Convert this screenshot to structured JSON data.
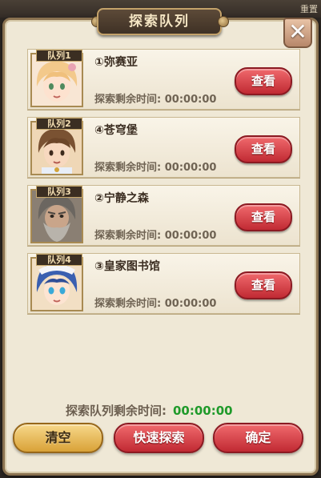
{
  "background": {
    "top_right_text": "重置"
  },
  "dialog": {
    "title": "探索队列",
    "close_symbol": "✕"
  },
  "queues": [
    {
      "tag": "队列1",
      "location": "①弥赛亚",
      "remaining_label": "探索剩余时间:",
      "remaining_time": "00:00:00",
      "button": "查看",
      "portrait": "blonde-girl-portrait"
    },
    {
      "tag": "队列2",
      "location": "④苍穹堡",
      "remaining_label": "探索剩余时间:",
      "remaining_time": "00:00:00",
      "button": "查看",
      "portrait": "brown-haired-boy-portrait"
    },
    {
      "tag": "队列3",
      "location": "②宁静之森",
      "remaining_label": "探索剩余时间:",
      "remaining_time": "00:00:00",
      "button": "查看",
      "portrait": "grey-bearded-man-portrait"
    },
    {
      "tag": "队列4",
      "location": "③皇家图书馆",
      "remaining_label": "探索剩余时间:",
      "remaining_time": "00:00:00",
      "button": "查看",
      "portrait": "blue-haired-girl-portrait"
    }
  ],
  "footer": {
    "total_label": "探索队列剩余时间:",
    "total_time": "00:00:00",
    "clear_button": "清空",
    "quick_explore_button": "快速探索",
    "confirm_button": "确定"
  },
  "colors": {
    "panel": "#efe8d6",
    "accent_red": "#c12a33",
    "accent_gold": "#d9a238",
    "timer_green": "#1f9a2a"
  }
}
